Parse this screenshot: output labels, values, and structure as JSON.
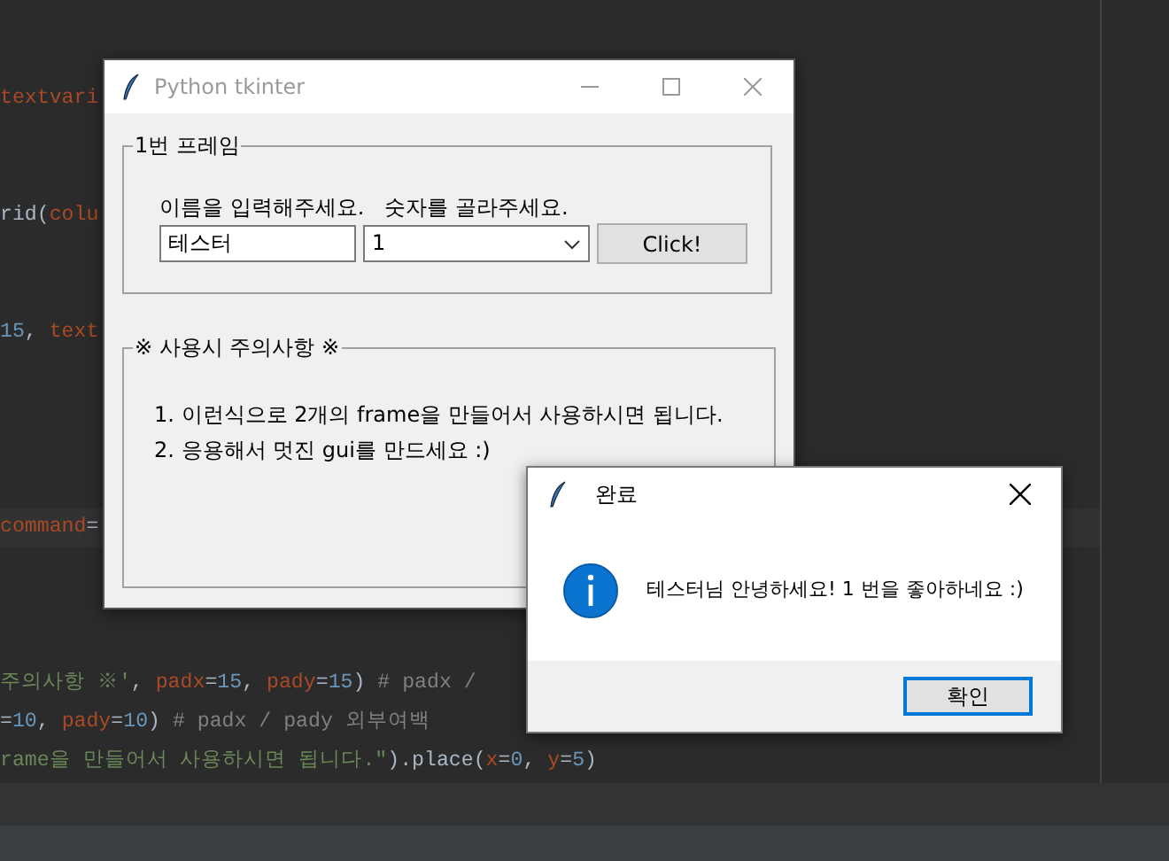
{
  "editor": {
    "code_lines": [
      {
        "current": false,
        "tokens": [
          {
            "text": "textvari",
            "kind": "param"
          }
        ]
      },
      {
        "current": false,
        "tokens": [
          {
            "text": "rid(",
            "kind": "plain"
          },
          {
            "text": "colu",
            "kind": "param"
          }
        ]
      },
      {
        "current": false,
        "tokens": [
          {
            "text": "15",
            "kind": "number"
          },
          {
            "text": ", ",
            "kind": "plain"
          },
          {
            "text": "text",
            "kind": "param"
          }
        ]
      },
      {
        "current": true,
        "tokens": [
          {
            "text": "command",
            "kind": "param"
          },
          {
            "text": "=",
            "kind": "plain"
          }
        ]
      },
      {
        "current": false,
        "tokens": [
          {
            "text": "주의사항 ※'",
            "kind": "string"
          },
          {
            "text": ", ",
            "kind": "plain"
          },
          {
            "text": "padx",
            "kind": "param"
          },
          {
            "text": "=",
            "kind": "plain"
          },
          {
            "text": "15",
            "kind": "number"
          },
          {
            "text": ", ",
            "kind": "plain"
          },
          {
            "text": "pady",
            "kind": "param"
          },
          {
            "text": "=",
            "kind": "plain"
          },
          {
            "text": "15",
            "kind": "number"
          },
          {
            "text": ") ",
            "kind": "plain"
          },
          {
            "text": "# padx /",
            "kind": "comment"
          }
        ]
      },
      {
        "current": false,
        "tokens": [
          {
            "text": "=",
            "kind": "plain"
          },
          {
            "text": "10",
            "kind": "number"
          },
          {
            "text": ", ",
            "kind": "plain"
          },
          {
            "text": "pady",
            "kind": "param"
          },
          {
            "text": "=",
            "kind": "plain"
          },
          {
            "text": "10",
            "kind": "number"
          },
          {
            "text": ") ",
            "kind": "plain"
          },
          {
            "text": "# padx / pady 외부여백",
            "kind": "comment"
          }
        ]
      },
      {
        "current": false,
        "tokens": [
          {
            "text": "rame을 만들어서 사용하시면 됩니다.\"",
            "kind": "string"
          },
          {
            "text": ").place(",
            "kind": "plain"
          },
          {
            "text": "x",
            "kind": "param"
          },
          {
            "text": "=",
            "kind": "plain"
          },
          {
            "text": "0",
            "kind": "number"
          },
          {
            "text": ", ",
            "kind": "plain"
          },
          {
            "text": "y",
            "kind": "param"
          },
          {
            "text": "=",
            "kind": "plain"
          },
          {
            "text": "5",
            "kind": "number"
          },
          {
            "text": ")",
            "kind": "plain"
          }
        ]
      }
    ]
  },
  "main_window": {
    "title": "Python tkinter",
    "frame_1": {
      "label": "1번 프레임",
      "name_label": "이름을 입력해주세요.",
      "number_label": "숫자를 골라주세요.",
      "name_input": {
        "value": "테스터"
      },
      "number_combo": {
        "value": "1"
      },
      "button": "Click!"
    },
    "frame_2": {
      "label": "※ 사용시 주의사항 ※",
      "lines": [
        "1. 이런식으로 2개의 frame을 만들어서 사용하시면 됩니다.",
        "2. 응용해서 멋진 gui를 만드세요 :)"
      ]
    }
  },
  "dialog": {
    "title": "완료",
    "message": "테스터님 안녕하세요! 1 번을 좋아하네요 :)",
    "button": "확인"
  }
}
